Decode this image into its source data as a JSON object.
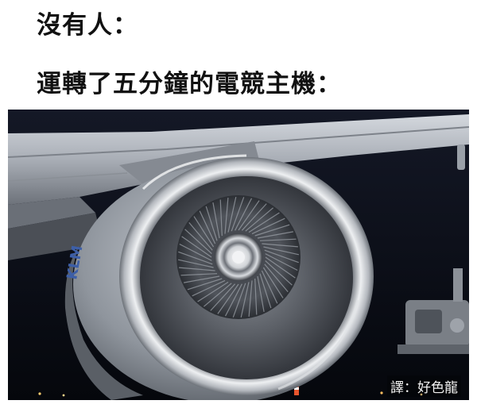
{
  "captions": {
    "line1": "沒有人：",
    "line2": "運轉了五分鐘的電競主機："
  },
  "photo": {
    "subject": "jet-engine",
    "watermark": "譯：好色龍"
  },
  "colors": {
    "sky": "#0b0e16",
    "wing": "#b9bec6",
    "nacelle": "#9aa0a8",
    "inlet_lip": "#d8dbe0",
    "fan": "#4a4e55",
    "spinner": "#e6e8ea"
  }
}
